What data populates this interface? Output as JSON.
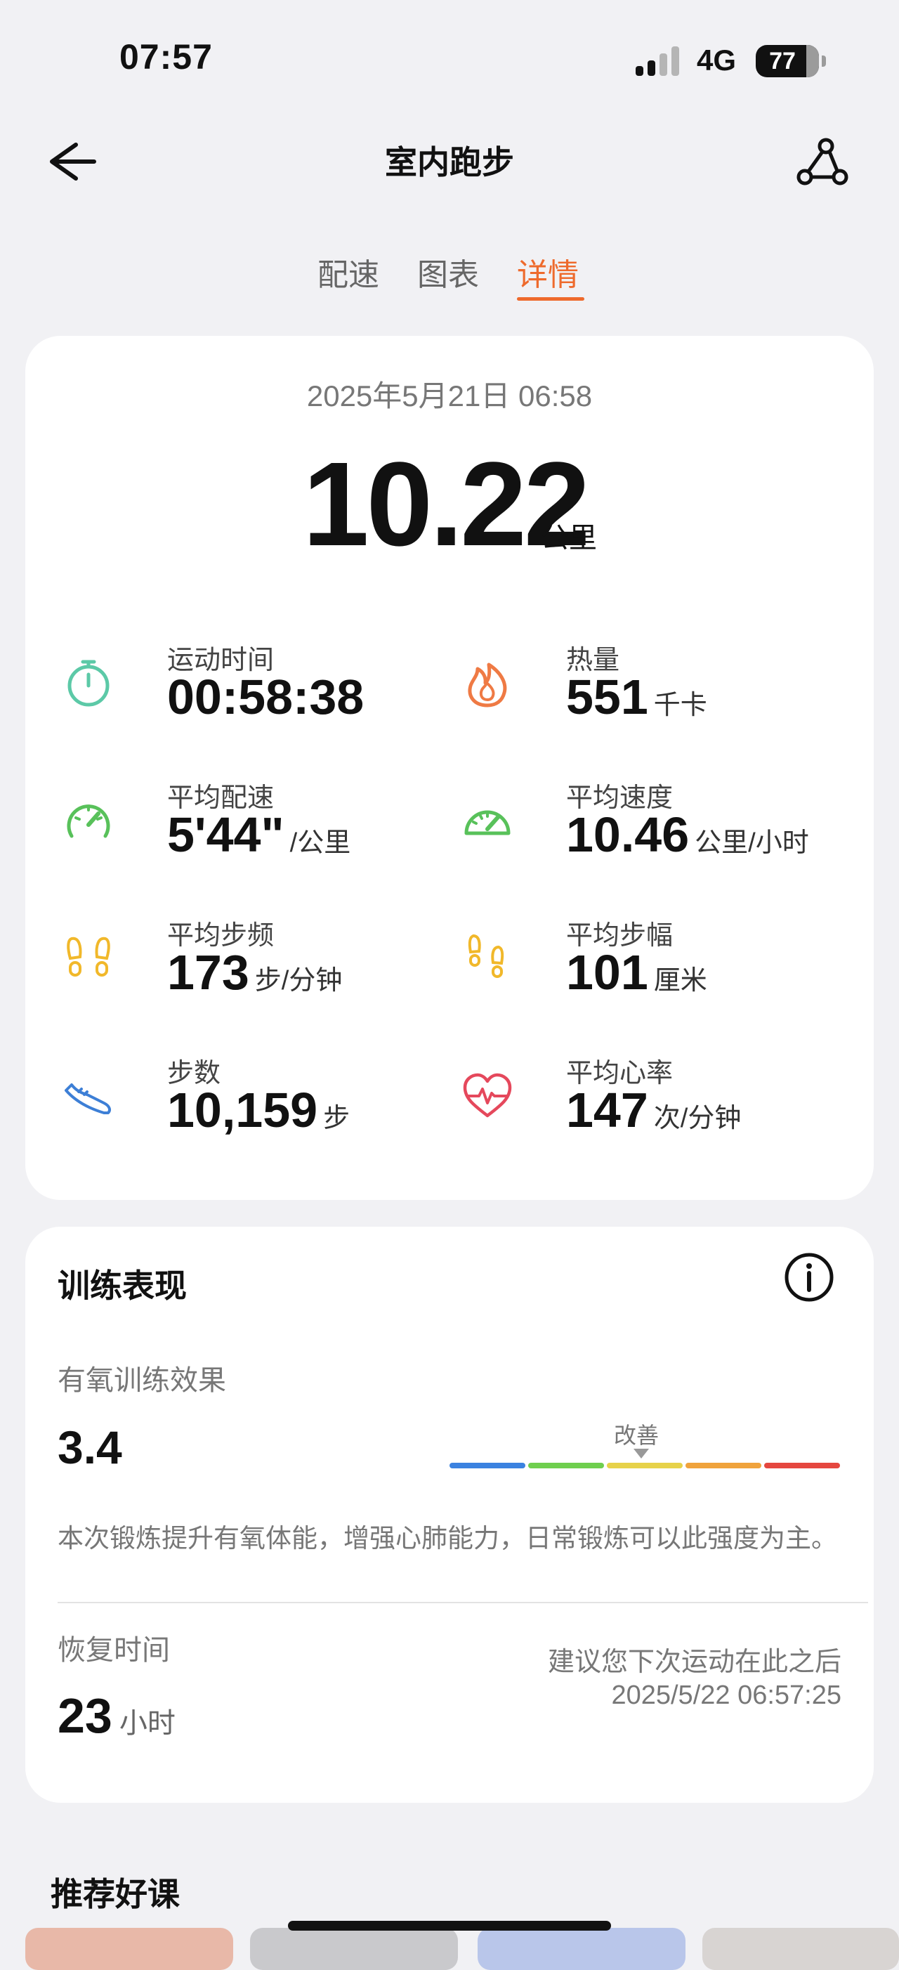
{
  "status_bar": {
    "time": "07:57",
    "network": "4G",
    "battery": "77"
  },
  "nav": {
    "title": "室内跑步"
  },
  "tabs": [
    {
      "label": "配速",
      "active": false
    },
    {
      "label": "图表",
      "active": false
    },
    {
      "label": "详情",
      "active": true
    }
  ],
  "summary": {
    "date": "2025年5月21日 06:58",
    "distance": "10.22",
    "distance_unit": "公里",
    "metrics": [
      {
        "label": "运动时间",
        "value": "00:58:38",
        "unit": "",
        "icon": "timer-icon",
        "color": "#5cc9a7"
      },
      {
        "label": "热量",
        "value": "551",
        "unit": "千卡",
        "icon": "flame-icon",
        "color": "#ef7a44"
      },
      {
        "label": "平均配速",
        "value": "5'44\"",
        "unit": "/公里",
        "icon": "pace-gauge-icon",
        "color": "#58c15a"
      },
      {
        "label": "平均速度",
        "value": "10.46",
        "unit": "公里/小时",
        "icon": "speedometer-icon",
        "color": "#58c15a"
      },
      {
        "label": "平均步频",
        "value": "173",
        "unit": "步/分钟",
        "icon": "footprints-icon",
        "color": "#f1b82a"
      },
      {
        "label": "平均步幅",
        "value": "101",
        "unit": "厘米",
        "icon": "small-footprints-icon",
        "color": "#f1b82a"
      },
      {
        "label": "步数",
        "value": "10,159",
        "unit": "步",
        "icon": "shoe-icon",
        "color": "#3d7fd6"
      },
      {
        "label": "平均心率",
        "value": "147",
        "unit": "次/分钟",
        "icon": "heart-rate-icon",
        "color": "#e5485c"
      }
    ]
  },
  "training": {
    "title": "训练表现",
    "aerobic_label": "有氧训练效果",
    "aerobic_value": "3.4",
    "grade": "改善",
    "scale_colors": [
      "#3b82e0",
      "#6fcf4e",
      "#e7d24a",
      "#f0a33c",
      "#e5473f"
    ],
    "description": "本次锻炼提升有氧体能，增强心肺能力，日常锻炼可以此强度为主。",
    "recovery_label": "恢复时间",
    "recovery_value": "23",
    "recovery_unit": "小时",
    "recommend_line1": "建议您下次运动在此之后",
    "recommend_line2": "2025/5/22 06:57:25"
  },
  "recommend": {
    "title": "推荐好课"
  }
}
